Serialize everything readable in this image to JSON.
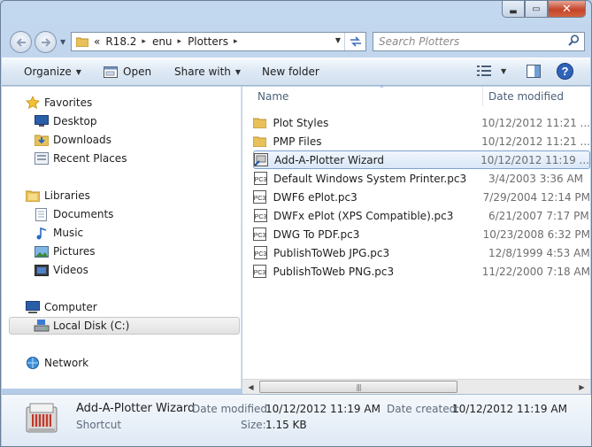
{
  "window": {
    "caption_buttons": [
      "minimize",
      "maximize",
      "close"
    ]
  },
  "address": {
    "overflow_chevron": "«",
    "crumbs": [
      "R18.2",
      "enu",
      "Plotters"
    ],
    "separator": "▸"
  },
  "search": {
    "placeholder": "Search Plotters"
  },
  "toolbar": {
    "organize": "Organize",
    "open": "Open",
    "share_with": "Share with",
    "new_folder": "New folder"
  },
  "nav": {
    "favorites": "Favorites",
    "desktop": "Desktop",
    "downloads": "Downloads",
    "recent_places": "Recent Places",
    "libraries": "Libraries",
    "documents": "Documents",
    "music": "Music",
    "pictures": "Pictures",
    "videos": "Videos",
    "computer": "Computer",
    "local_disk": "Local Disk (C:)",
    "network": "Network"
  },
  "columns": {
    "name": "Name",
    "date_modified": "Date modified"
  },
  "files": [
    {
      "name": "Plot Styles",
      "date": "10/12/2012 11:21 ...",
      "icon": "folder-icon"
    },
    {
      "name": "PMP Files",
      "date": "10/12/2012 11:21 ...",
      "icon": "folder-icon"
    },
    {
      "name": "Add-A-Plotter Wizard",
      "date": "10/12/2012 11:19 ...",
      "icon": "shortcut-icon"
    },
    {
      "name": "Default Windows System Printer.pc3",
      "date": "3/4/2003 3:36 AM",
      "icon": "pc3-file-icon"
    },
    {
      "name": "DWF6 ePlot.pc3",
      "date": "7/29/2004 12:14 PM",
      "icon": "pc3-file-icon"
    },
    {
      "name": "DWFx ePlot (XPS Compatible).pc3",
      "date": "6/21/2007 7:17 PM",
      "icon": "pc3-file-icon"
    },
    {
      "name": "DWG To PDF.pc3",
      "date": "10/23/2008 6:32 PM",
      "icon": "pc3-file-icon"
    },
    {
      "name": "PublishToWeb JPG.pc3",
      "date": "12/8/1999 4:53 AM",
      "icon": "pc3-file-icon"
    },
    {
      "name": "PublishToWeb PNG.pc3",
      "date": "11/22/2000 7:18 AM",
      "icon": "pc3-file-icon"
    }
  ],
  "details": {
    "title": "Add-A-Plotter Wizard",
    "type": "Shortcut",
    "date_modified_label": "Date modified:",
    "date_modified_value": "10/12/2012 11:19 AM",
    "date_created_label": "Date created:",
    "date_created_value": "10/12/2012 11:19 AM",
    "size_label": "Size:",
    "size_value": "1.15 KB"
  }
}
